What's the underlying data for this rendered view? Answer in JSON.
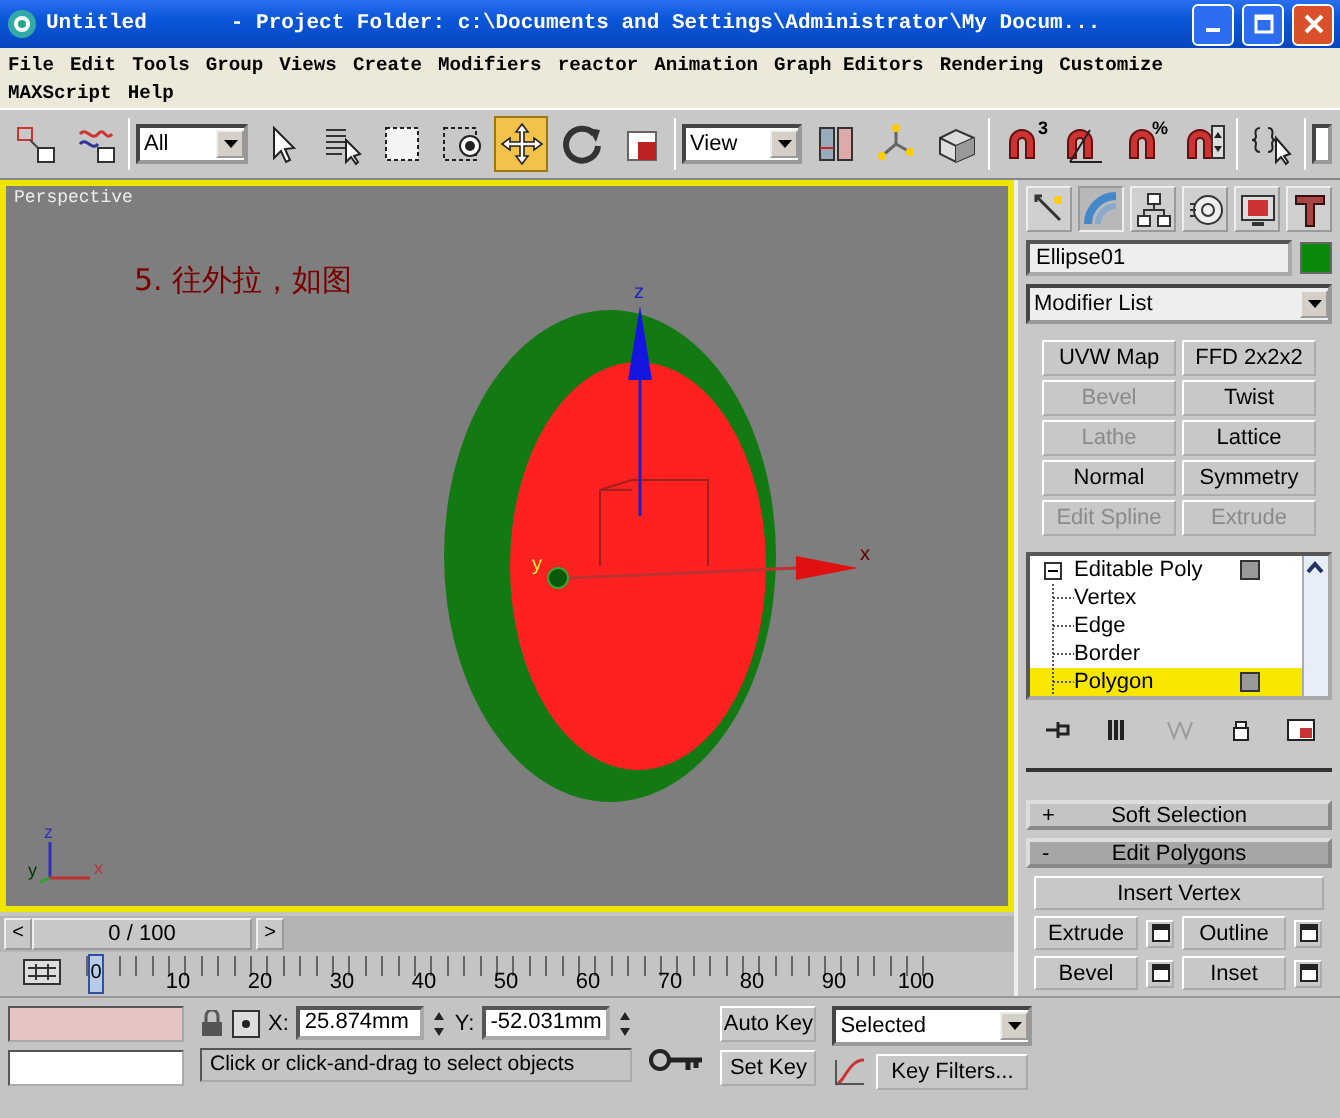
{
  "window": {
    "title": "Untitled",
    "subtitle": "- Project Folder: c:\\Documents and Settings\\Administrator\\My Docum..."
  },
  "menu": [
    "File",
    "Edit",
    "Tools",
    "Group",
    "Views",
    "Create",
    "Modifiers",
    "reactor",
    "Animation",
    "Graph Editors",
    "Rendering",
    "Customize",
    "MAXScript",
    "Help"
  ],
  "toolbar": [
    {
      "kind": "icon",
      "selected": false
    },
    {
      "kind": "icon",
      "selected": false
    },
    {
      "kind": "dropdown",
      "value": "All"
    },
    {
      "kind": "icon",
      "selected": false
    },
    {
      "kind": "icon",
      "selected": false
    },
    {
      "kind": "icon",
      "selected": false
    },
    {
      "kind": "icon",
      "selected": false
    },
    {
      "kind": "icon",
      "selected": true
    },
    {
      "kind": "icon",
      "selected": false
    },
    {
      "kind": "icon",
      "selected": false
    },
    {
      "kind": "dropdown",
      "value": "View"
    },
    {
      "kind": "icon",
      "selected": false
    },
    {
      "kind": "icon",
      "selected": false
    },
    {
      "kind": "icon",
      "selected": false
    },
    {
      "kind": "icon",
      "selected": false,
      "label": "3"
    },
    {
      "kind": "icon",
      "selected": false
    },
    {
      "kind": "icon",
      "selected": false,
      "label": "%"
    },
    {
      "kind": "icon",
      "selected": false
    },
    {
      "kind": "icon",
      "selected": false
    },
    {
      "kind": "field"
    }
  ],
  "viewport": {
    "label": "Perspective",
    "annotation": "5. 往外拉，如图",
    "gizmo_labels": [
      "z",
      "y",
      "x"
    ],
    "tripod_labels": [
      "z",
      "y",
      "x"
    ]
  },
  "command_panel": {
    "tabs": [
      {
        "selected": false
      },
      {
        "selected": true
      },
      {
        "selected": false
      },
      {
        "selected": false
      },
      {
        "selected": false
      },
      {
        "selected": false
      }
    ],
    "object_name": "Ellipse01",
    "modifier_list": "Modifier List",
    "modifier_buttons": [
      {
        "label": "UVW Map",
        "disabled": false
      },
      {
        "label": "FFD 2x2x2",
        "disabled": false
      },
      {
        "label": "Bevel",
        "disabled": true
      },
      {
        "label": "Twist",
        "disabled": false
      },
      {
        "label": "Lathe",
        "disabled": true
      },
      {
        "label": "Lattice",
        "disabled": false
      },
      {
        "label": "Normal",
        "disabled": false
      },
      {
        "label": "Symmetry",
        "disabled": false
      },
      {
        "label": "Edit Spline",
        "disabled": true
      },
      {
        "label": "Extrude",
        "disabled": true
      }
    ],
    "stack": [
      {
        "label": "Editable Poly",
        "expanded": true,
        "children": [
          {
            "label": "Vertex",
            "selected": false
          },
          {
            "label": "Edge",
            "selected": false
          },
          {
            "label": "Border",
            "selected": false
          },
          {
            "label": "Polygon",
            "selected": true
          }
        ]
      }
    ],
    "rollouts": [
      {
        "toggle": "+",
        "label": "Soft Selection",
        "expanded": false
      },
      {
        "toggle": "-",
        "label": "Edit Polygons",
        "expanded": true,
        "buttons": [
          {
            "label": "Insert Vertex",
            "settings": false
          },
          {
            "label": "Extrude",
            "settings": true
          },
          {
            "label": "Outline",
            "settings": true
          },
          {
            "label": "Bevel",
            "settings": true
          },
          {
            "label": "Inset",
            "settings": true
          }
        ]
      }
    ]
  },
  "time_slider": {
    "prev": "<",
    "position": "0 / 100",
    "next": ">",
    "level": 0
  },
  "ruler": {
    "current": "0",
    "labels": [
      "10",
      "20",
      "30",
      "40",
      "50",
      "60",
      "70",
      "80",
      "90",
      "100"
    ]
  },
  "status": {
    "x_label": "X:",
    "x": "25.874mm",
    "y_label": "Y:",
    "y": "-52.031mm",
    "prompt": "Click or click-and-drag to select objects",
    "auto_key": "Auto Key",
    "set_key": "Set Key",
    "key_mode": "Selected",
    "key_filters": "Key Filters..."
  }
}
